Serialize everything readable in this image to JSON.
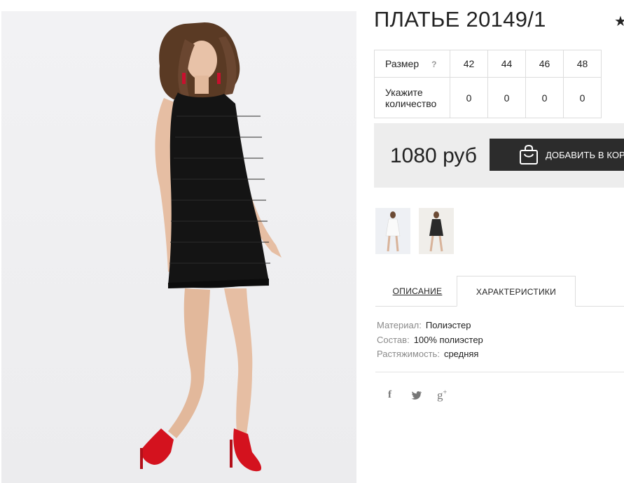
{
  "product": {
    "title": "ПЛАТЬЕ 20149/1",
    "favorite_icon": "star-icon"
  },
  "sizes": {
    "size_label": "Размер",
    "help_mark": "?",
    "qty_label_line1": "Укажите",
    "qty_label_line2": "количество",
    "values": [
      "42",
      "44",
      "46",
      "48"
    ],
    "quantities": [
      "0",
      "0",
      "0",
      "0"
    ]
  },
  "purchase": {
    "price": "1080 руб",
    "add_to_cart": "ДОБАВИТЬ В КОРЗИНУ",
    "cart_icon": "shopping-bag-icon"
  },
  "tabs": [
    {
      "label": "ОПИСАНИЕ",
      "active": false
    },
    {
      "label": "ХАРАКТЕРИСТИКИ",
      "active": true
    }
  ],
  "characteristics": [
    {
      "key": "Материал:",
      "value": "Полиэстер"
    },
    {
      "key": "Состав:",
      "value": "100% полиэстер"
    },
    {
      "key": "Растяжимость:",
      "value": "средняя"
    }
  ],
  "social": {
    "facebook": "f",
    "twitter": "🐦",
    "google_plus": "g"
  },
  "colors": {
    "dark_button": "#2c2c2c",
    "price_bg": "#ededed",
    "border": "#dddddd",
    "shoe_red": "#d4121e"
  }
}
